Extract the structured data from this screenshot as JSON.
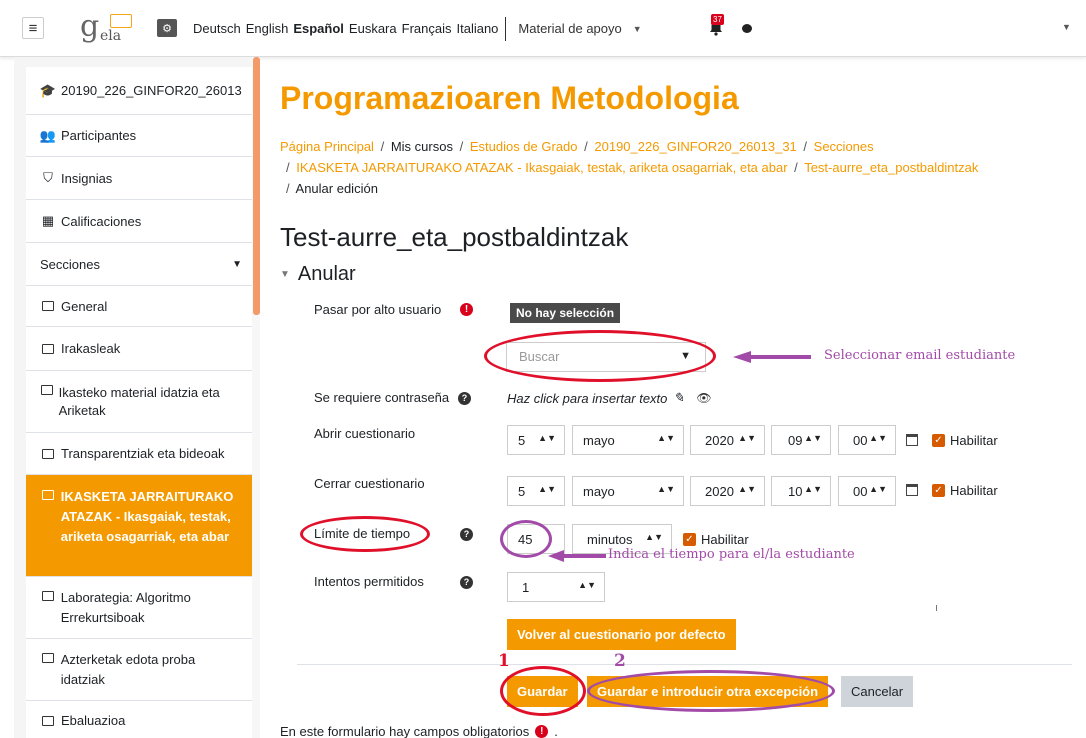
{
  "navbar": {
    "menu_icon": "hamburger-icon",
    "logo_text_g": "g",
    "logo_text_ela": "ela",
    "languages": [
      "Deutsch",
      "English",
      "Español",
      "Euskara",
      "Français",
      "Italiano"
    ],
    "active_language": "Español",
    "support_label": "Material de apoyo",
    "notification_count": "37"
  },
  "sidebar": {
    "items": [
      {
        "icon": "graduation-cap-icon",
        "label": "20190_226_GINFOR20_26013"
      },
      {
        "icon": "users-icon",
        "label": "Participantes"
      },
      {
        "icon": "shield-icon",
        "label": "Insignias"
      },
      {
        "icon": "table-icon",
        "label": "Calificaciones"
      },
      {
        "icon": "",
        "label": "Secciones"
      },
      {
        "icon": "folder-icon",
        "label": "General"
      },
      {
        "icon": "folder-icon",
        "label": "Irakasleak"
      },
      {
        "icon": "folder-icon",
        "label": "Ikasteko material idatzia eta Ariketak"
      },
      {
        "icon": "folder-icon",
        "label": "Transparentziak eta bideoak"
      },
      {
        "icon": "folder-icon",
        "label": "IKASKETA JARRAITURAKO ATAZAK - Ikasgaiak, testak, ariketa osagarriak, eta abar"
      },
      {
        "icon": "folder-icon",
        "label": "Laborategia: Algoritmo Errekurtsiboak"
      },
      {
        "icon": "folder-icon",
        "label": "Azterketak edota proba idatziak"
      },
      {
        "icon": "folder-icon",
        "label": "Ebaluazioa"
      }
    ]
  },
  "main": {
    "page_title": "Programazioaren Metodologia",
    "breadcrumb": {
      "home": "Página Principal",
      "mycourses": "Mis cursos",
      "degree": "Estudios de Grado",
      "course": "20190_226_GINFOR20_26013_31",
      "sections": "Secciones",
      "section": "IKASKETA JARRAITURAKO ATAZAK - Ikasgaiak, testak, ariketa osagarriak, eta abar",
      "quiz": "Test-aurre_eta_postbaldintzak",
      "current": "Anular edición",
      "separator": "/"
    },
    "quiz_title": "Test-aurre_eta_postbaldintzak",
    "fieldset_legend": "Anular"
  },
  "form": {
    "user_label": "Pasar por alto usuario",
    "no_selection": "No hay selección",
    "search_placeholder": "Buscar",
    "password_label": "Se requiere contraseña",
    "password_value": "Haz click para insertar texto",
    "open_label": "Abrir cuestionario",
    "open": {
      "day": "5",
      "month": "mayo",
      "year": "2020",
      "hour": "09",
      "minute": "00"
    },
    "close_label": "Cerrar cuestionario",
    "close": {
      "day": "5",
      "month": "mayo",
      "year": "2020",
      "hour": "10",
      "minute": "00"
    },
    "enable_label": "Habilitar",
    "timelimit_label": "Límite de tiempo",
    "timelimit_value": "45",
    "timelimit_unit": "minutos",
    "attempts_label": "Intentos permitidos",
    "attempts_value": "1",
    "revert_button": "Volver al cuestionario por defecto",
    "save_button": "Guardar",
    "save_another_button": "Guardar e introducir otra excepción",
    "cancel_button": "Cancelar",
    "footer_note": "En este formulario hay campos obligatorios",
    "footer_end": "."
  },
  "annotations": {
    "select_email": "Seleccionar email estudiante",
    "time_hint": "Indica el tiempo para el/la estudiante",
    "num1": "1",
    "num2": "2"
  },
  "colors": {
    "accent": "#f49a00",
    "annotation_red": "#e0102a",
    "annotation_purple": "#a24aa8"
  }
}
